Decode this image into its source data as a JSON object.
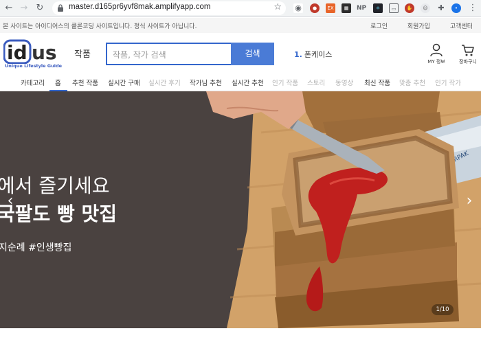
{
  "browser": {
    "url": "master.d165pr6yvf8mak.amplifyapp.com",
    "extensions": [
      "camera-ext",
      "ublock-ext",
      "ex-ext",
      "grid-ext",
      "np-ext",
      "react-ext",
      "cast-ext",
      "abp-ext",
      "ghost-ext",
      "puzzle-ext",
      "profile-ext"
    ],
    "ext_labels": {
      "ex": "EX",
      "np": "NP"
    }
  },
  "notice": {
    "text": "본 사이트는 아이디어스의 클론코딩 사이트입니다. 정식 사이트가 아닙니다.",
    "links": [
      "로그인",
      "회원가입",
      "고객센터"
    ]
  },
  "header": {
    "logo_text": "idus",
    "logo_sub": "Unique Lifestyle Guide",
    "category_label": "작품",
    "search_placeholder": "작품, 작가 검색",
    "search_button": "검색",
    "rank_number": "1.",
    "rank_text": "폰케이스",
    "my_label": "MY 정보",
    "cart_label": "장바구니"
  },
  "nav": {
    "items": [
      {
        "label": "카테고리"
      },
      {
        "label": "홈"
      },
      {
        "label": "추천 작품"
      },
      {
        "label": "실시간 구매"
      },
      {
        "label": "실시간 후기"
      },
      {
        "label": "작가님 추천"
      },
      {
        "label": "실시간 추천"
      },
      {
        "label": "인기 작품"
      },
      {
        "label": "스토리"
      },
      {
        "label": "동영상"
      },
      {
        "label": "최신 작품"
      },
      {
        "label": "맞춤 추천"
      },
      {
        "label": "인기 작가"
      }
    ]
  },
  "hero": {
    "line1": "에서 즐기세요",
    "line2": "국팔도 빵 맛집",
    "tags": "지순례 #인생빵집",
    "pager": "1/10",
    "package_text": "LURPAK"
  },
  "colors": {
    "accent": "#4a7bd6",
    "search_border": "#3366cc",
    "hero_bg": "#4a4240"
  }
}
